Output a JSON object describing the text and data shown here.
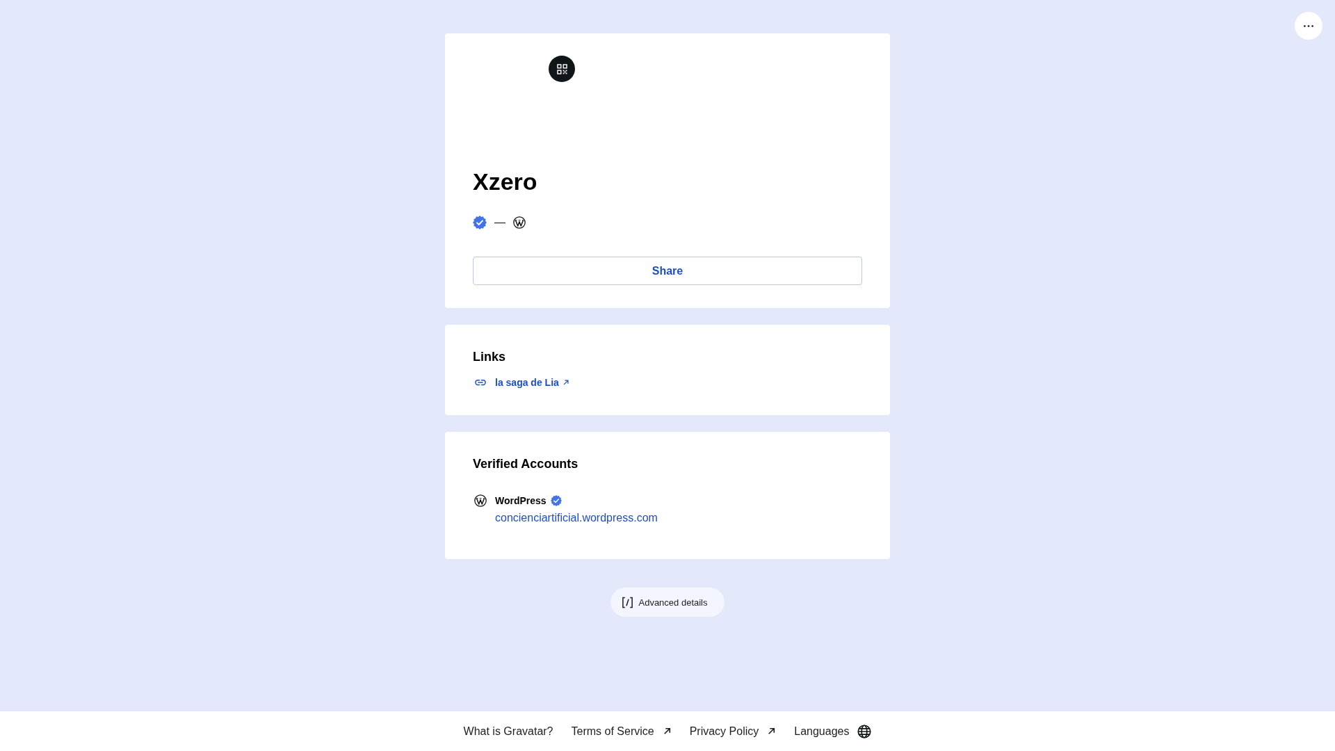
{
  "profile": {
    "name": "Xzero",
    "verified": true,
    "separator": "—",
    "share_button": "Share"
  },
  "links": {
    "title": "Links",
    "items": [
      {
        "label": "la saga de Lia"
      }
    ]
  },
  "verified_accounts": {
    "title": "Verified Accounts",
    "items": [
      {
        "service": "WordPress",
        "verified": true,
        "url": "concienciartificial.wordpress.com"
      }
    ]
  },
  "advanced_button": "Advanced details",
  "footer": {
    "links": [
      {
        "label": "What is Gravatar?",
        "kind": "internal"
      },
      {
        "label": "Terms of Service",
        "kind": "external"
      },
      {
        "label": "Privacy Policy",
        "kind": "external"
      },
      {
        "label": "Languages",
        "kind": "language"
      }
    ]
  }
}
